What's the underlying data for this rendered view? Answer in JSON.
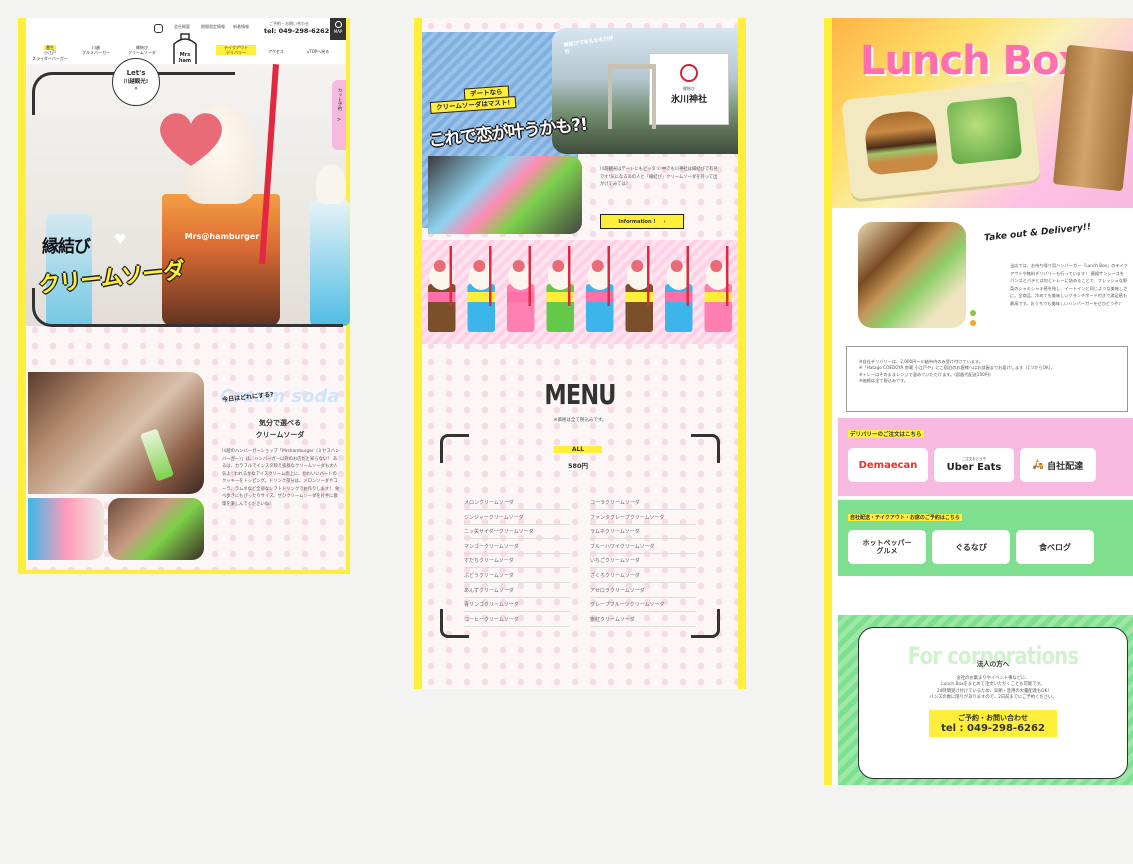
{
  "page1": {
    "nav": {
      "items": [
        {
          "small": "番生",
          "label": "小江戸\nスライダーバーガー"
        },
        {
          "small": "",
          "label": "川越\nグルメバーガー"
        },
        {
          "small": "",
          "label": "縁結び\nクリームソーダ"
        },
        {
          "small": "",
          "label": "テイクアウト\nデリバリー"
        },
        {
          "small": "",
          "label": "アクセス"
        },
        {
          "small": "",
          "label": "TOPへ戻る"
        }
      ],
      "links": [
        "会社概要",
        "期間限定情報",
        "新着情報"
      ],
      "contact_label": "ご予約・お問い合わせ",
      "tel": "tel: 049-298-6262",
      "map_label": "MAP",
      "instagram": "instagram-icon"
    },
    "logo": {
      "line1": "Mrs",
      "line2": "ham",
      "line3": "burger"
    },
    "bubble": {
      "line1": "Let's",
      "line2": "川越観光!",
      "arrow": "»"
    },
    "side_tab": "カット予約",
    "hero": {
      "line1": "縁結び",
      "line2": "クリームソーダ",
      "cup_brand": "Mrs@hamburger"
    },
    "section": {
      "kicker": "今日はどれにする?",
      "title_en": "Cream soda",
      "heading1": "気分で選べる",
      "heading2": "クリームソーダ",
      "body": "川越のハンバーガーショップ「Mrshamburger（ミセスハンバーガー）」は、ハンバーガー以外のお店だと知らない？ あるは、カラフルでインスタ映え抜群なクリームソーダも大人気よ♡われるかなアイスクリームの上に、かわいいハートのクッキーをトッピング。ドリンク部分は、メロンソーダやコーラ、ラムネなど全部なシフトドリンクでお作りします！ 食べ歩きにもぴったりサイズ。ぜひクリームソーダを片手に散策を楽しんでくださいね！"
    }
  },
  "page2": {
    "tag1": "デートなら",
    "tag2": "クリームソーダはマスト!",
    "headline": "これで恋が叶うかも?!",
    "photo_caption": "縁結びで有名な氷川神社",
    "shrine_sign_small": "縁結び",
    "shrine_sign": "氷川神社",
    "text": "川越観光はデートにもピッタリ!中でも川神社は縁結びで有名です!気になるあの人と「縁結び」クリームソーダを持って出かけてみては?",
    "info_button": "Information !",
    "menu": {
      "title": "MENU",
      "note": "※価格は全て税込みです。",
      "category": "ALL",
      "price": "580円",
      "left": [
        "メロンクリームソーダ",
        "ジンジャークリームソーダ",
        "ニッ矢サイダークリームソーダ",
        "マンゴークリームソーダ",
        "すだちクリームソーダ",
        "ぶどうクリームソーダ",
        "あんずクリームソーダ",
        "青リンゴクリームソーダ",
        "コーヒークリームソーダ"
      ],
      "right": [
        "コーラクリームソーダ",
        "ファンタグレープクリームソーダ",
        "ラムネクリームソーダ",
        "ブルーハワイクリームソーダ",
        "いちごクリームソーダ",
        "ざくろクリームソーダ",
        "アセロラクリームソーダ",
        "グレープフルーツクリームソーダ",
        "夜紅クリームソーダ"
      ]
    },
    "cup_colors": [
      "#7a4f2a",
      "#3cb6ea",
      "#ff7fb0",
      "#63c94b",
      "#3cb6ea",
      "#7a4f2a",
      "#3cb6ea",
      "#ff7fb0"
    ]
  },
  "page3": {
    "title": "Lunch Box",
    "takeout_title": "Take out & Delivery!!",
    "takeout_text": "当店では、お持ち帰り用ハンバーガー「Lunch Box」のテイクアウトや無料デリバリーも行っています！ 唐揚サンシースをパンズとパテとは何とトレーに詰めることで、フレッシュな野菜のシャキシャキ感を残し、イートインと同じような美味しさに。全商品、冷めても美味しいクランチボード付きで満足感も最高です。おうちでも美味しいハンバーガーをぜひどうぞ♪",
    "notes": [
      "※自社デリバリーは、2,000円〜川越市内のみ受け付けています。",
      "※「Hatago COEDOYA 房蔵 小江戸や」にご宿泊のお客様へはお部屋までお届けします（1つからOK）。",
      "※トレーはそのままレンジで温めていただけます。(容器代配送100円)",
      "※価格は全て税込みです。"
    ],
    "delivery_heading": "デリバリーのご注文はこちら",
    "delivery_buttons": [
      "Demaecan",
      "Uber Eats",
      "自社配達"
    ],
    "uber_small": "ご注文をどうぞ",
    "reserve_heading": "自社配送・テイクアウト・お席のご予約はこちら",
    "reserve_buttons": [
      "ホットペッパー\nグルメ",
      "ぐるなび",
      "食べログ"
    ],
    "corp_title_en": "For corporations",
    "corp_heading": "法人の方へ",
    "corp_text": [
      "会社のお集まりやイベント事などに、",
      "Lunch Boxをまとめて注文いただくことも可能です。",
      "24時間受け付けているため、早朝・急用の大量配達もOK!",
      "バンズの数に限りがありますので、2日前までにご予約ください。"
    ],
    "corp_contact_label": "ご予約・お問い合わせ",
    "corp_tel": "tel : 049-298-6262"
  },
  "colors": {
    "yellow": "#ffef3b",
    "pink": "#f7b9e0",
    "green": "#7ee08f",
    "demaecan": "#e4332a"
  }
}
